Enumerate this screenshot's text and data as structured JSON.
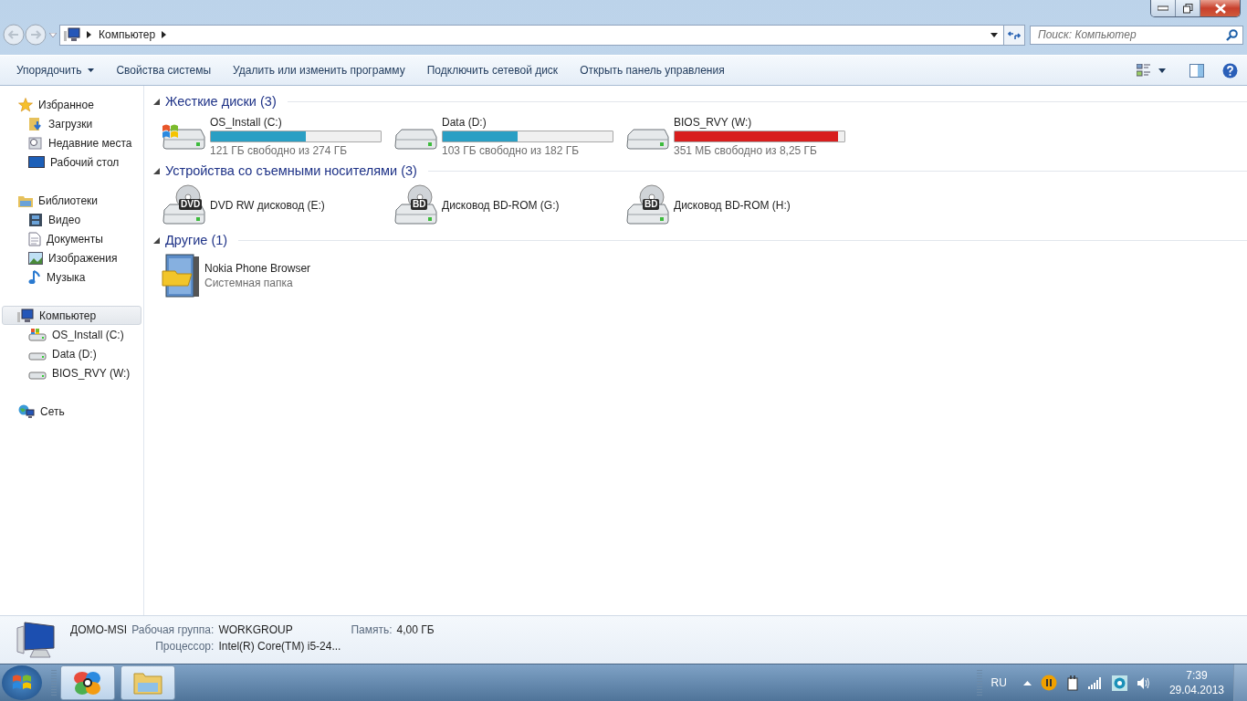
{
  "address_bar": {
    "breadcrumb": [
      "Компьютер"
    ]
  },
  "search": {
    "placeholder": "Поиск: Компьютер"
  },
  "toolbar": {
    "buttons": [
      {
        "label": "Упорядочить",
        "kind": "menu"
      },
      {
        "label": "Свойства системы",
        "kind": "plain"
      },
      {
        "label": "Удалить или изменить программу",
        "kind": "plain"
      },
      {
        "label": "Подключить сетевой диск",
        "kind": "plain"
      },
      {
        "label": "Открыть панель управления",
        "kind": "plain"
      }
    ]
  },
  "sidebar": {
    "sections": [
      {
        "label": "Избранное",
        "selected": false,
        "children": [
          {
            "label": "Загрузки",
            "selected": false
          },
          {
            "label": "Недавние места",
            "selected": false
          },
          {
            "label": "Рабочий стол",
            "selected": false
          }
        ]
      },
      {
        "label": "Библиотеки",
        "selected": false,
        "children": [
          {
            "label": "Видео",
            "selected": false
          },
          {
            "label": "Документы",
            "selected": false
          },
          {
            "label": "Изображения",
            "selected": false
          },
          {
            "label": "Музыка",
            "selected": false
          }
        ]
      },
      {
        "label": "Компьютер",
        "selected": true,
        "children": [
          {
            "label": "OS_Install (C:)",
            "selected": false
          },
          {
            "label": "Data (D:)",
            "selected": false
          },
          {
            "label": "BIOS_RVY (W:)",
            "selected": false
          }
        ]
      },
      {
        "label": "Сеть",
        "selected": false
      }
    ]
  },
  "groups": [
    {
      "title": "Жесткие диски (3)",
      "expanded": true,
      "items": [
        {
          "kind": "drive",
          "name": "OS_Install (C:)",
          "level": 0.56,
          "color": "#2a9fc4",
          "reading": "121 ГБ свободно из 274 ГБ"
        },
        {
          "kind": "drive",
          "name": "Data (D:)",
          "level": 0.44,
          "color": "#2a9fc4",
          "reading": "103 ГБ свободно из 182 ГБ"
        },
        {
          "kind": "drive",
          "name": "BIOS_RVY (W:)",
          "level": 0.96,
          "color": "#d81e1e",
          "reading": "351 МБ свободно из 8,25 ГБ"
        }
      ]
    },
    {
      "title": "Устройства со съемными носителями (3)",
      "expanded": true,
      "items": [
        {
          "kind": "optical",
          "name": "DVD RW дисковод (E:)",
          "badge": "DVD"
        },
        {
          "kind": "optical",
          "name": "Дисковод BD-ROM (G:)",
          "badge": "BD"
        },
        {
          "kind": "optical",
          "name": "Дисковод BD-ROM (H:)",
          "badge": "BD"
        }
      ]
    },
    {
      "title": "Другие (1)",
      "expanded": true,
      "items": [
        {
          "kind": "folder",
          "name": "Nokia Phone Browser",
          "subtitle": "Системная папка"
        }
      ]
    }
  ],
  "details": {
    "name": "ДОМО-MSI",
    "fields": [
      {
        "label": "Рабочая группа:",
        "value": "WORKGROUP"
      },
      {
        "label": "Память:",
        "value": "4,00 ГБ"
      },
      {
        "label": "Процессор:",
        "value": "Intel(R) Core(TM) i5-24..."
      }
    ]
  },
  "taskbar": {
    "language": "RU",
    "time": "7:39",
    "date": "29.04.2013"
  }
}
